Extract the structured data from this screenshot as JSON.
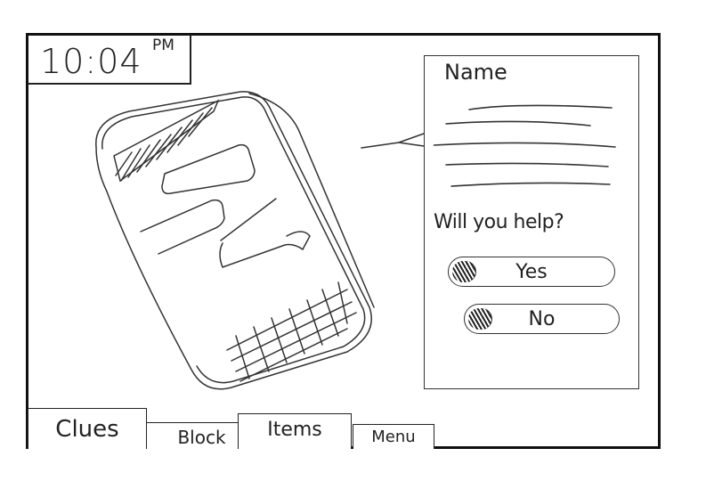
{
  "clock": {
    "time": "10:04",
    "ampm": "PM"
  },
  "dialog": {
    "name_label": "Name",
    "question": "Will you help?",
    "yes_label": "Yes",
    "no_label": "No"
  },
  "tabs": [
    {
      "label": "Clues",
      "active": true
    },
    {
      "label": "Block",
      "active": false
    },
    {
      "label": "Items",
      "active": false
    },
    {
      "label": "Menu",
      "active": false
    }
  ],
  "icons": {
    "phone": "phone-device-icon",
    "pointer": "speech-pointer-icon"
  }
}
